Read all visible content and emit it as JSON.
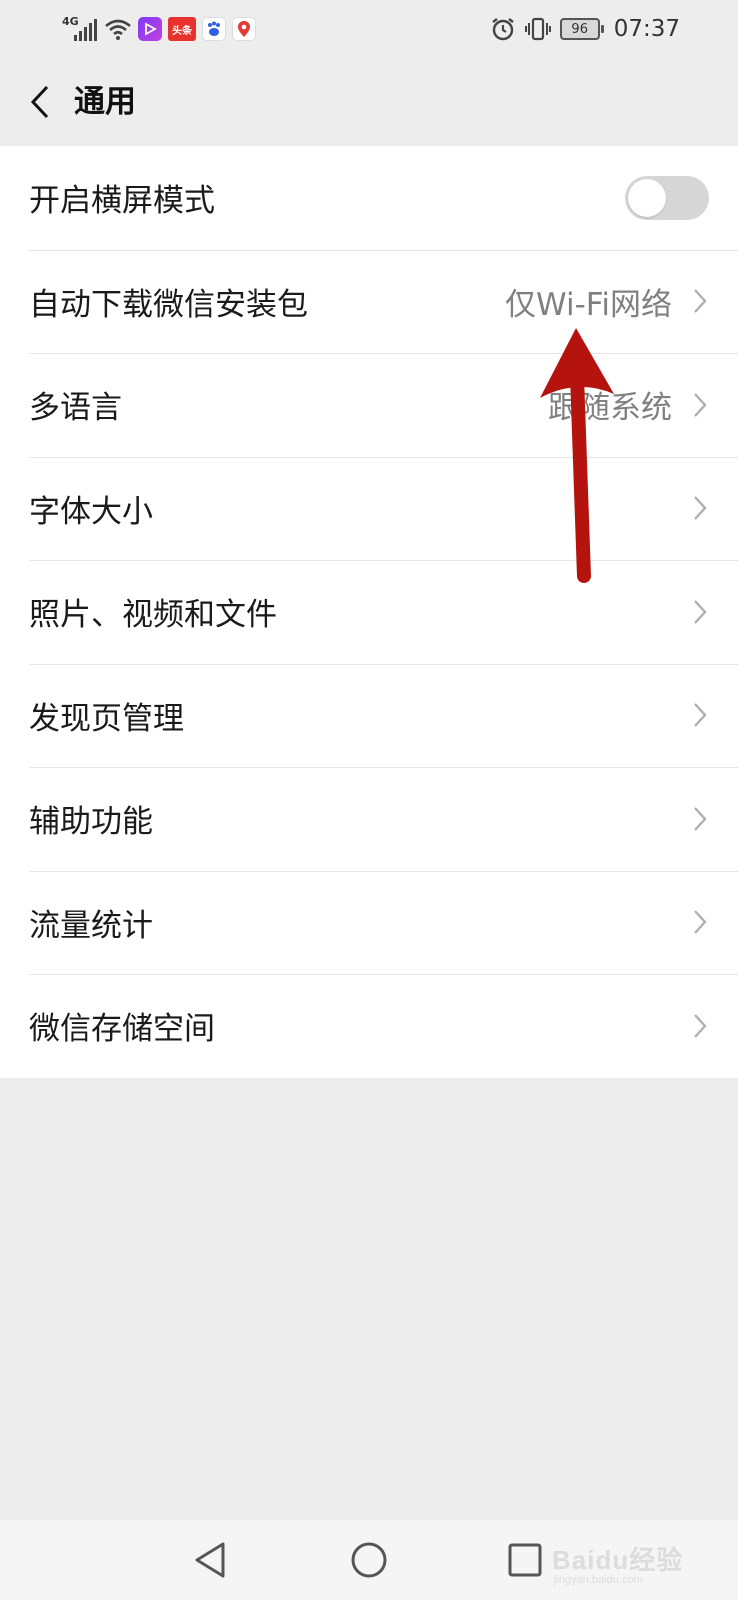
{
  "status_bar": {
    "network_label": "4G",
    "toutiao_label": "头条",
    "battery_level": "96",
    "time": "07:37",
    "icons": [
      "signal-icon",
      "wifi-icon",
      "video-app-icon",
      "toutiao-app-icon",
      "baidu-app-icon",
      "map-app-icon",
      "alarm-icon",
      "vibrate-icon",
      "battery-icon"
    ]
  },
  "header": {
    "title": "通用",
    "back_icon": "chevron-left-icon"
  },
  "settings": {
    "items": [
      {
        "label": "开启横屏模式",
        "type": "toggle",
        "enabled": false
      },
      {
        "label": "自动下载微信安装包",
        "value": "仅Wi-Fi网络"
      },
      {
        "label": "多语言",
        "value": "跟随系统"
      },
      {
        "label": "字体大小"
      },
      {
        "label": "照片、视频和文件"
      },
      {
        "label": "发现页管理"
      },
      {
        "label": "辅助功能"
      },
      {
        "label": "流量统计"
      },
      {
        "label": "微信存储空间"
      }
    ]
  },
  "nav_bar": {
    "icons": [
      "back-triangle-icon",
      "home-circle-icon",
      "recents-square-icon"
    ]
  },
  "watermark": {
    "text": "Baidu经验",
    "sub": "jingyan.baidu.com"
  },
  "colors": {
    "background": "#ededed",
    "list_background": "#ffffff",
    "secondary_text": "#808080",
    "annotation_arrow": "#b5140e"
  }
}
